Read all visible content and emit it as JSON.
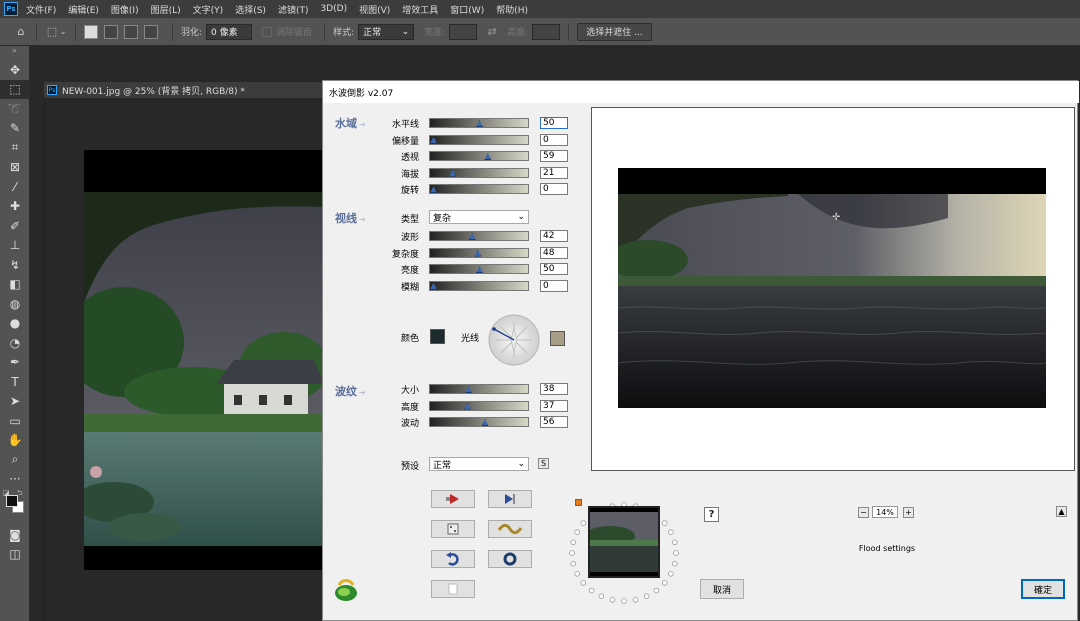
{
  "menubar": {
    "logo": "Ps",
    "items": [
      "文件(F)",
      "编辑(E)",
      "图像(I)",
      "图层(L)",
      "文字(Y)",
      "选择(S)",
      "滤镜(T)",
      "3D(D)",
      "视图(V)",
      "增效工具",
      "窗口(W)",
      "帮助(H)"
    ]
  },
  "options": {
    "feather_label": "羽化:",
    "feather_value": "0 像素",
    "antialias_label": "消除锯齿",
    "style_label": "样式:",
    "style_value": "正常",
    "width_label": "宽度:",
    "height_label": "高度:",
    "select_mask_label": "选择并遮住 ..."
  },
  "tools": {
    "collapse": "»",
    "items": [
      {
        "name": "move-tool",
        "glyph": "✥"
      },
      {
        "name": "marquee-tool",
        "glyph": "⬚",
        "active": true
      },
      {
        "name": "lasso-tool",
        "glyph": "➰"
      },
      {
        "name": "quick-select-tool",
        "glyph": "✎"
      },
      {
        "name": "crop-tool",
        "glyph": "⌗"
      },
      {
        "name": "frame-tool",
        "glyph": "⊠"
      },
      {
        "name": "eyedropper-tool",
        "glyph": "⁄"
      },
      {
        "name": "healing-tool",
        "glyph": "✚"
      },
      {
        "name": "brush-tool",
        "glyph": "✐"
      },
      {
        "name": "stamp-tool",
        "glyph": "⊥"
      },
      {
        "name": "history-brush-tool",
        "glyph": "↯"
      },
      {
        "name": "eraser-tool",
        "glyph": "◧"
      },
      {
        "name": "gradient-tool",
        "glyph": "◍"
      },
      {
        "name": "blur-tool",
        "glyph": "●"
      },
      {
        "name": "dodge-tool",
        "glyph": "◔"
      },
      {
        "name": "pen-tool",
        "glyph": "✒"
      },
      {
        "name": "type-tool",
        "glyph": "T"
      },
      {
        "name": "path-select-tool",
        "glyph": "➤"
      },
      {
        "name": "rectangle-tool",
        "glyph": "▭"
      },
      {
        "name": "hand-tool",
        "glyph": "✋"
      },
      {
        "name": "zoom-tool",
        "glyph": "⌕"
      },
      {
        "name": "more-tools",
        "glyph": "···"
      }
    ]
  },
  "document": {
    "tab_title": "NEW-001.jpg @ 25% (背景 拷贝, RGB/8) *",
    "tab_icon": "Ps"
  },
  "dialog": {
    "title": "水波倒影 v2.07",
    "sections": {
      "water": "水域",
      "view": "视线",
      "ripple": "波纹"
    },
    "water_params": [
      {
        "label": "水平线",
        "value": "50"
      },
      {
        "label": "偏移量",
        "value": "0"
      },
      {
        "label": "透视",
        "value": "59"
      },
      {
        "label": "海拔",
        "value": "21"
      },
      {
        "label": "旋转",
        "value": "0"
      }
    ],
    "type_label": "类型",
    "type_value": "复杂",
    "view_params": [
      {
        "label": "波形",
        "value": "42"
      },
      {
        "label": "复杂度",
        "value": "48"
      },
      {
        "label": "亮度",
        "value": "50"
      },
      {
        "label": "模糊",
        "value": "0"
      }
    ],
    "color_label": "颜色",
    "light_label": "光线",
    "color_swatch": "#1e2b2e",
    "light_swatch": "#a89e88",
    "ripple_params": [
      {
        "label": "大小",
        "value": "38"
      },
      {
        "label": "高度",
        "value": "37"
      },
      {
        "label": "波动",
        "value": "56"
      }
    ],
    "preset_label": "预设",
    "preset_value": "正常",
    "preset_save": "S",
    "help": "?",
    "zoom_minus": "−",
    "zoom_value": "14%",
    "zoom_plus": "+",
    "collapse_btn": "▲",
    "status": "Flood settings",
    "cancel": "取消",
    "ok": "確定"
  }
}
